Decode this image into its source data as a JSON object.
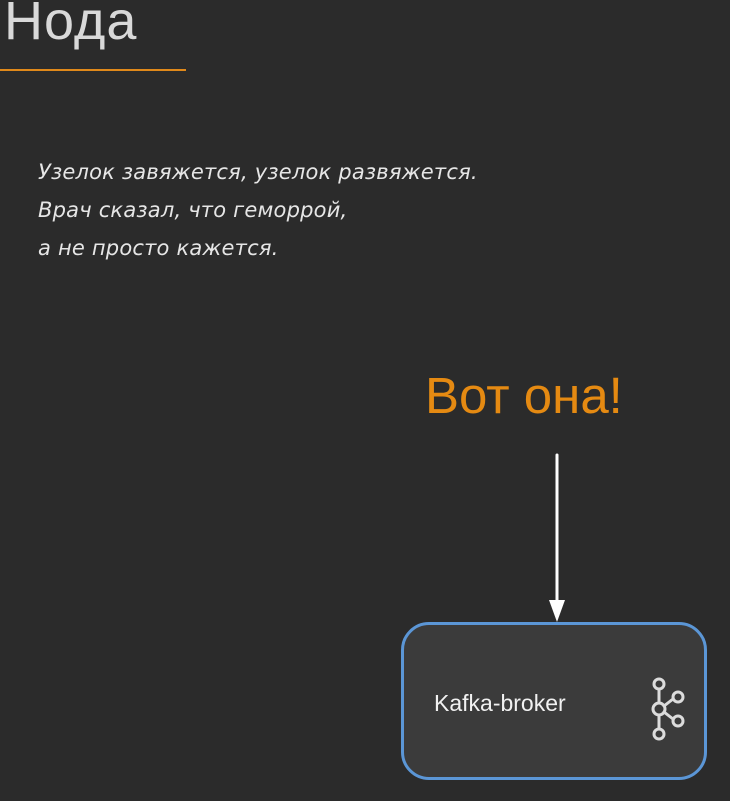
{
  "slide": {
    "title": "Нода",
    "poem_lines": [
      "Узелок завяжется, узелок развяжется.",
      "Врач сказал, что геморрой,",
      "а не просто кажется."
    ],
    "callout": "Вот она!",
    "node": {
      "label": "Kafka-broker",
      "icon": "kafka-logo-icon"
    }
  },
  "colors": {
    "background": "#2b2b2b",
    "accent": "#e58a12",
    "node_border": "#5b96d6"
  }
}
